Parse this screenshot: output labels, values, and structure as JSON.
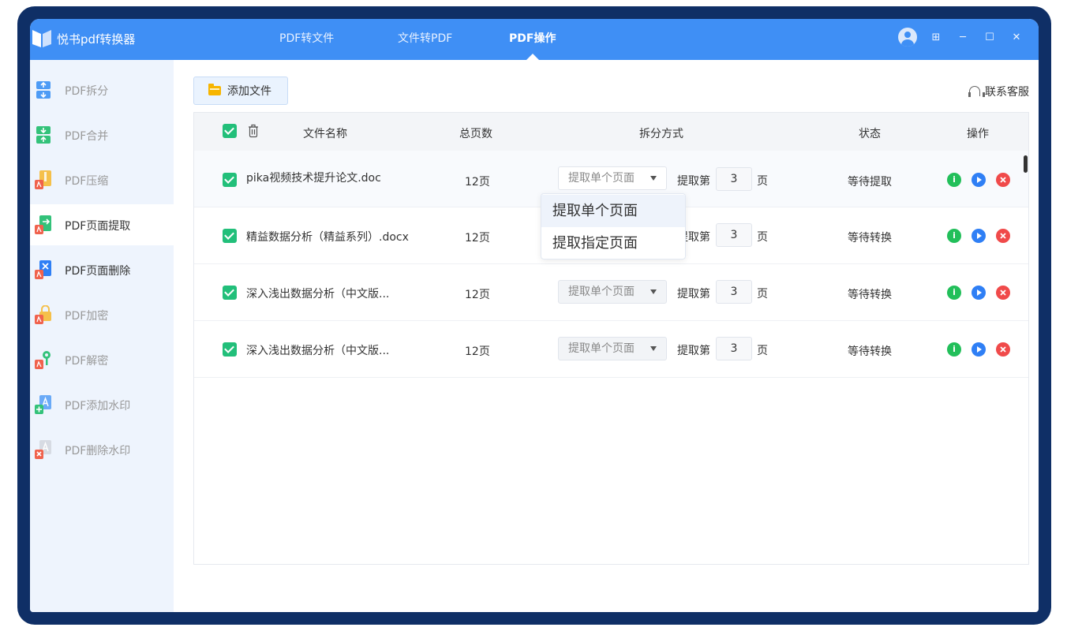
{
  "app": {
    "title": "悦书pdf转换器"
  },
  "nav": {
    "tabs": [
      {
        "label": "PDF转文件"
      },
      {
        "label": "文件转PDF"
      },
      {
        "label": "PDF操作"
      }
    ],
    "active": "PDF操作"
  },
  "window_controls": {
    "grid": "⊞",
    "minimize": "─",
    "maximize": "☐",
    "close": "✕"
  },
  "sidebar": {
    "items": [
      {
        "label": "PDF拆分",
        "icon": "pdf-split-icon"
      },
      {
        "label": "PDF合并",
        "icon": "pdf-merge-icon"
      },
      {
        "label": "PDF压缩",
        "icon": "pdf-compress-icon"
      },
      {
        "label": "PDF页面提取",
        "icon": "pdf-extract-icon"
      },
      {
        "label": "PDF页面删除",
        "icon": "pdf-delete-page-icon"
      },
      {
        "label": "PDF加密",
        "icon": "pdf-lock-icon"
      },
      {
        "label": "PDF解密",
        "icon": "pdf-unlock-icon"
      },
      {
        "label": "PDF添加水印",
        "icon": "pdf-add-watermark-icon"
      },
      {
        "label": "PDF删除水印",
        "icon": "pdf-remove-watermark-icon"
      }
    ],
    "active_index": 3
  },
  "toolbar": {
    "add_file": "添加文件",
    "support": "联系客服"
  },
  "table": {
    "headers": {
      "name": "文件名称",
      "pages": "总页数",
      "split_mode": "拆分方式",
      "status": "状态",
      "ops": "操作"
    },
    "extract_label": "提取第",
    "page_unit": "页",
    "rows": [
      {
        "name": "pika视频技术提升论文.doc",
        "pages": "12页",
        "mode": "提取单个页面",
        "page_no": "3",
        "status": "等待提取"
      },
      {
        "name": "精益数据分析（精益系列）.docx",
        "pages": "12页",
        "mode": "提取单个页面",
        "page_no": "3",
        "status": "等待转换"
      },
      {
        "name": "深入浅出数据分析（中文版...",
        "pages": "12页",
        "mode": "提取单个页面",
        "page_no": "3",
        "status": "等待转换"
      },
      {
        "name": "深入浅出数据分析（中文版...",
        "pages": "12页",
        "mode": "提取单个页面",
        "page_no": "3",
        "status": "等待转换"
      }
    ]
  },
  "dropdown": {
    "options": [
      "提取单个页面",
      "提取指定页面"
    ]
  },
  "ops": {
    "info": "i"
  },
  "colors": {
    "accent": "#3f8ff5",
    "frame": "#0f2f66",
    "check": "#22bf7a",
    "info": "#22bf5a",
    "play": "#2f7ff5",
    "delete": "#f04a4a"
  }
}
